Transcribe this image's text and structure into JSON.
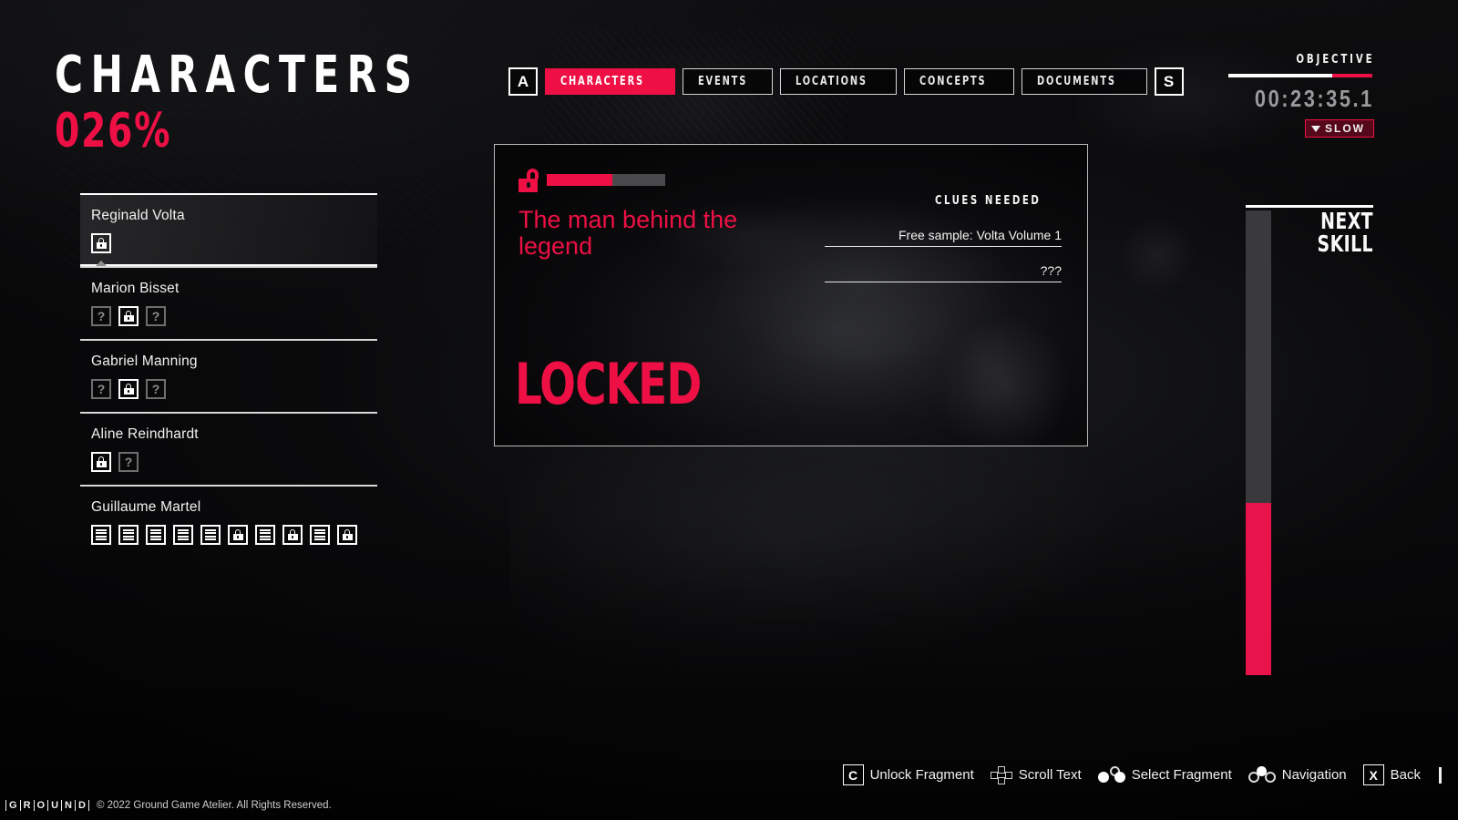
{
  "accent": "#ee1045",
  "page": {
    "title": "CHARACTERS",
    "percent": "026%"
  },
  "characters": [
    {
      "name": "Reginald Volta",
      "selected": true,
      "fragments": [
        {
          "type": "lock",
          "state": "locked"
        }
      ]
    },
    {
      "name": "Marion Bisset",
      "selected": false,
      "fragments": [
        {
          "type": "unknown",
          "state": "hidden",
          "glyph": "?"
        },
        {
          "type": "lock",
          "state": "locked"
        },
        {
          "type": "unknown",
          "state": "hidden",
          "glyph": "?"
        }
      ]
    },
    {
      "name": "Gabriel Manning",
      "selected": false,
      "fragments": [
        {
          "type": "unknown",
          "state": "hidden",
          "glyph": "?"
        },
        {
          "type": "lock",
          "state": "locked"
        },
        {
          "type": "unknown",
          "state": "hidden",
          "glyph": "?"
        }
      ]
    },
    {
      "name": "Aline Reindhardt",
      "selected": false,
      "fragments": [
        {
          "type": "lock",
          "state": "locked"
        },
        {
          "type": "unknown",
          "state": "hidden",
          "glyph": "?"
        }
      ]
    },
    {
      "name": "Guillaume Martel",
      "selected": false,
      "fragments": [
        {
          "type": "doc",
          "state": "unlocked"
        },
        {
          "type": "doc",
          "state": "unlocked"
        },
        {
          "type": "doc",
          "state": "unlocked"
        },
        {
          "type": "doc",
          "state": "unlocked"
        },
        {
          "type": "doc",
          "state": "unlocked"
        },
        {
          "type": "lock",
          "state": "locked"
        },
        {
          "type": "doc",
          "state": "unlocked"
        },
        {
          "type": "lock",
          "state": "locked"
        },
        {
          "type": "doc",
          "state": "unlocked"
        },
        {
          "type": "lock",
          "state": "locked"
        }
      ]
    }
  ],
  "tabs": {
    "prev_key": "A",
    "next_key": "S",
    "items": [
      {
        "label": "CHARACTERS",
        "active": true
      },
      {
        "label": "EVENTS",
        "active": false
      },
      {
        "label": "LOCATIONS",
        "active": false
      },
      {
        "label": "CONCEPTS",
        "active": false
      },
      {
        "label": "DOCUMENTS",
        "active": false
      }
    ]
  },
  "card": {
    "lock_icon": "lock-open-icon",
    "progress_percent": 55,
    "title": "The man behind the legend",
    "status": "LOCKED",
    "clues_heading": "CLUES NEEDED",
    "clues": [
      "Free sample: Volta Volume 1",
      "???"
    ]
  },
  "objective": {
    "label": "OBJECTIVE",
    "bar_white_percent": 72,
    "timer": "00:23:35.1",
    "badge": "SLOW"
  },
  "skill": {
    "label_line1": "NEXT",
    "label_line2": "SKILL",
    "fill_percent": 37
  },
  "hints": [
    {
      "key": "C",
      "icon": "key-c",
      "label": "Unlock Fragment"
    },
    {
      "key": "",
      "icon": "dpad-icon",
      "label": "Scroll Text"
    },
    {
      "key": "",
      "icon": "sticks-icon",
      "label": "Select Fragment"
    },
    {
      "key": "",
      "icon": "nav-sticks-icon",
      "label": "Navigation"
    },
    {
      "key": "X",
      "icon": "key-x",
      "label": "Back"
    }
  ],
  "footer": {
    "brand_letters": [
      "G",
      "R",
      "O",
      "U",
      "N",
      "D"
    ],
    "copyright": "© 2022 Ground Game Atelier. All Rights Reserved."
  }
}
